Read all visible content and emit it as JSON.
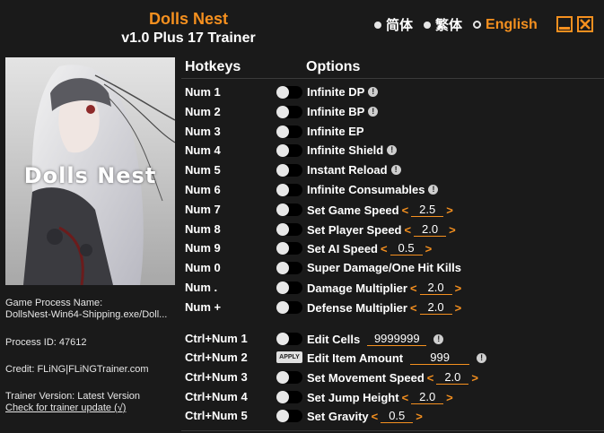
{
  "header": {
    "title": "Dolls Nest",
    "subtitle": "v1.0 Plus 17 Trainer",
    "languages": [
      {
        "label": "简体"
      },
      {
        "label": "繁体"
      },
      {
        "label": "English"
      }
    ],
    "accent_color": "#f5901f"
  },
  "cover": {
    "title_text": "Dolls Nest"
  },
  "sidebar": {
    "process_label": "Game Process Name:",
    "process_name": "DollsNest-Win64-Shipping.exe/Doll...",
    "process_id": "Process ID: 47612",
    "credit": "Credit: FLiNG|FLiNGTrainer.com",
    "version": "Trainer Version: Latest Version",
    "update_link": "Check for trainer update (√)"
  },
  "columns": {
    "hotkeys": "Hotkeys",
    "options": "Options"
  },
  "apply_label": "APPLY",
  "rows": [
    {
      "hotkey": "Num 1",
      "label": "Infinite DP"
    },
    {
      "hotkey": "Num 2",
      "label": "Infinite BP"
    },
    {
      "hotkey": "Num 3",
      "label": "Infinite EP"
    },
    {
      "hotkey": "Num 4",
      "label": "Infinite Shield"
    },
    {
      "hotkey": "Num 5",
      "label": "Instant Reload"
    },
    {
      "hotkey": "Num 6",
      "label": "Infinite Consumables"
    },
    {
      "hotkey": "Num 7",
      "label": "Set Game Speed",
      "value": "2.5"
    },
    {
      "hotkey": "Num 8",
      "label": "Set Player Speed",
      "value": "2.0"
    },
    {
      "hotkey": "Num 9",
      "label": "Set AI Speed",
      "value": "0.5"
    },
    {
      "hotkey": "Num 0",
      "label": "Super Damage/One Hit Kills"
    },
    {
      "hotkey": "Num .",
      "label": "Damage Multiplier",
      "value": "2.0"
    },
    {
      "hotkey": "Num +",
      "label": "Defense Multiplier",
      "value": "2.0"
    },
    {
      "hotkey": "Ctrl+Num 1",
      "label": "Edit Cells",
      "value": "9999999"
    },
    {
      "hotkey": "Ctrl+Num 2",
      "label": "Edit Item Amount",
      "value": "999"
    },
    {
      "hotkey": "Ctrl+Num 3",
      "label": "Set Movement Speed",
      "value": "2.0"
    },
    {
      "hotkey": "Ctrl+Num 4",
      "label": "Set Jump Height",
      "value": "2.0"
    },
    {
      "hotkey": "Ctrl+Num 5",
      "label": "Set Gravity",
      "value": "0.5"
    }
  ]
}
